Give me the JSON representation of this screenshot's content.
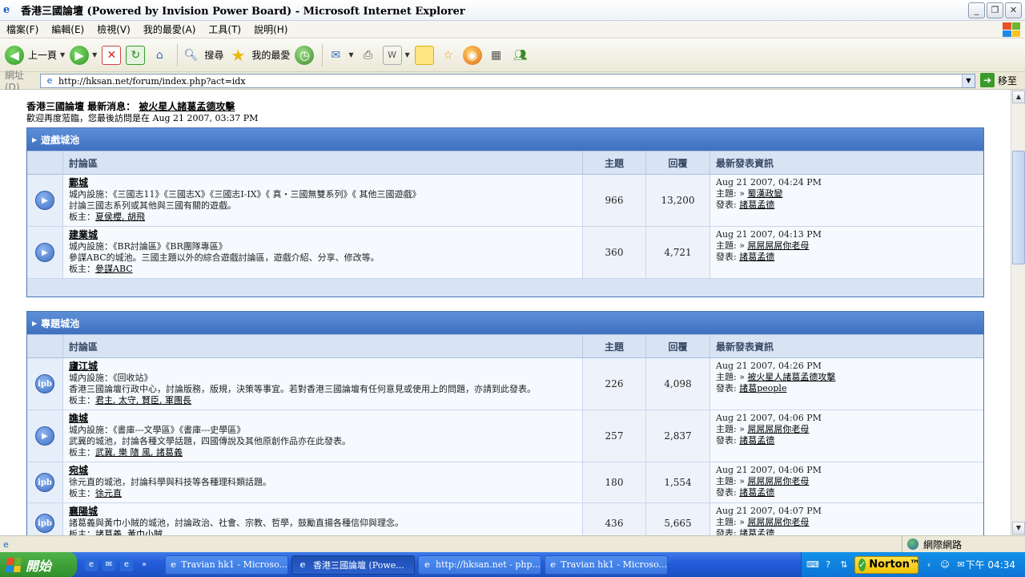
{
  "window": {
    "title": "香港三國論壇 (Powered by Invision Power Board) - Microsoft Internet Explorer",
    "buttons": [
      "_",
      "❐",
      "✕"
    ]
  },
  "menubar": {
    "items": [
      "檔案(F)",
      "編輯(E)",
      "檢視(V)",
      "我的最愛(A)",
      "工具(T)",
      "說明(H)"
    ]
  },
  "toolbar": {
    "back_label": "上一頁",
    "search_label": "搜尋",
    "favorites_label": "我的最愛"
  },
  "address": {
    "label": "網址(D)",
    "url": "http://hksan.net/forum/index.php?act=idx",
    "go_label": "移至"
  },
  "page": {
    "news_prefix": "香港三國論壇 最新消息：",
    "news_link": "被火星人諸葛孟德攻擊",
    "welcome": "歡迎再度蒞臨，您最後訪問是在 Aug 21 2007, 03:37 PM"
  },
  "columns": {
    "forum": "討論區",
    "topics": "主題",
    "replies": "回覆",
    "last_post": "最新發表資訊"
  },
  "categories": [
    {
      "title": "遊戲城池",
      "forums": [
        {
          "icon": "▶",
          "name": "鄴城",
          "line2": "城內設施：《三國志11》《三國志X》《三國志I-IX》《 真・三國無雙系列》《 其他三國遊戲》",
          "line3": "討論三國志系列或其他與三國有關的遊戲。",
          "mods_prefix": "板主：",
          "mods": "夏侯櫻, 胡飛",
          "topics": "966",
          "replies": "13,200",
          "last_time": "Aug 21 2007, 04:24 PM",
          "last_topic_prefix": "主題: »",
          "last_topic": "蜀漢政變",
          "last_by_prefix": "發表:",
          "last_by": "諸葛孟德"
        },
        {
          "icon": "▶",
          "name": "建業城",
          "line2": "城內設施：《BR討論區》《BR團隊專區》",
          "line3": "參謀ABC的城池。三國主題以外的綜合遊戲討論區，遊戲介紹、分享、修改等。",
          "mods_prefix": "板主：",
          "mods": "參謀ABC",
          "topics": "360",
          "replies": "4,721",
          "last_time": "Aug 21 2007, 04:13 PM",
          "last_topic_prefix": "主題: »",
          "last_topic": "屌屌屌屌你老母",
          "last_by_prefix": "發表:",
          "last_by": "諸葛孟德"
        }
      ]
    },
    {
      "title": "專題城池",
      "forums": [
        {
          "icon": "ipb",
          "name": "廬江城",
          "line2": "城內設施：《回收站》",
          "line3": "香港三國論壇行政中心，討論版務，版規，決策等事宜。若對香港三國論壇有任何意見或使用上的問題，亦請到此發表。",
          "mods_prefix": "板主：",
          "mods": "君主, 太守, 賢臣, 軍團長",
          "topics": "226",
          "replies": "4,098",
          "last_time": "Aug 21 2007, 04:26 PM",
          "last_topic_prefix": "主題: »",
          "last_topic": "被火星人諸葛孟德攻擊",
          "last_by_prefix": "發表:",
          "last_by": "諸葛people"
        },
        {
          "icon": "▶",
          "name": "譙城",
          "line2": "城內設施：《書庫---文學區》《書庫---史學區》",
          "line3": "武冀的城池，討論各種文學話題，四國傳說及其他原創作品亦在此發表。",
          "mods_prefix": "板主：",
          "mods": "武冀, 樂 隨 風, 諸葛義",
          "topics": "257",
          "replies": "2,837",
          "last_time": "Aug 21 2007, 04:06 PM",
          "last_topic_prefix": "主題: »",
          "last_topic": "屌屌屌屌你老母",
          "last_by_prefix": "發表:",
          "last_by": "諸葛孟德"
        },
        {
          "icon": "ipb",
          "name": "宛城",
          "line2": "徐元直的城池，討論科學與科技等各種理科類話題。",
          "line3": "",
          "mods_prefix": "板主：",
          "mods": "徐元直",
          "topics": "180",
          "replies": "1,554",
          "last_time": "Aug 21 2007, 04:06 PM",
          "last_topic_prefix": "主題: »",
          "last_topic": "屌屌屌屌你老母",
          "last_by_prefix": "發表:",
          "last_by": "諸葛孟德"
        },
        {
          "icon": "ipb",
          "name": "襄陽城",
          "line2": "諸葛義與黃巾小賊的城池，討論政治、社會、宗教、哲學，鼓勵直揚各種信仰與理念。",
          "line3": "",
          "mods_prefix": "板主：",
          "mods": "諸葛義, 黃巾小賊",
          "topics": "436",
          "replies": "5,665",
          "last_time": "Aug 21 2007, 04:07 PM",
          "last_topic_prefix": "主題: »",
          "last_topic": "屌屌屌屌你老母",
          "last_by_prefix": "發表:",
          "last_by": "諸葛孟德"
        }
      ]
    }
  ],
  "statusbar": {
    "zone": "網際網路"
  },
  "taskbar": {
    "start": "開始",
    "tasks": [
      {
        "label": "Travian hk1 - Microso...",
        "active": false
      },
      {
        "label": "香港三國論壇 (Powe...",
        "active": true
      },
      {
        "label": "http://hksan.net - php...",
        "active": false
      },
      {
        "label": "Travian hk1 - Microso...",
        "active": false
      }
    ],
    "norton": "Norton™",
    "clock": "下午 04:34"
  }
}
